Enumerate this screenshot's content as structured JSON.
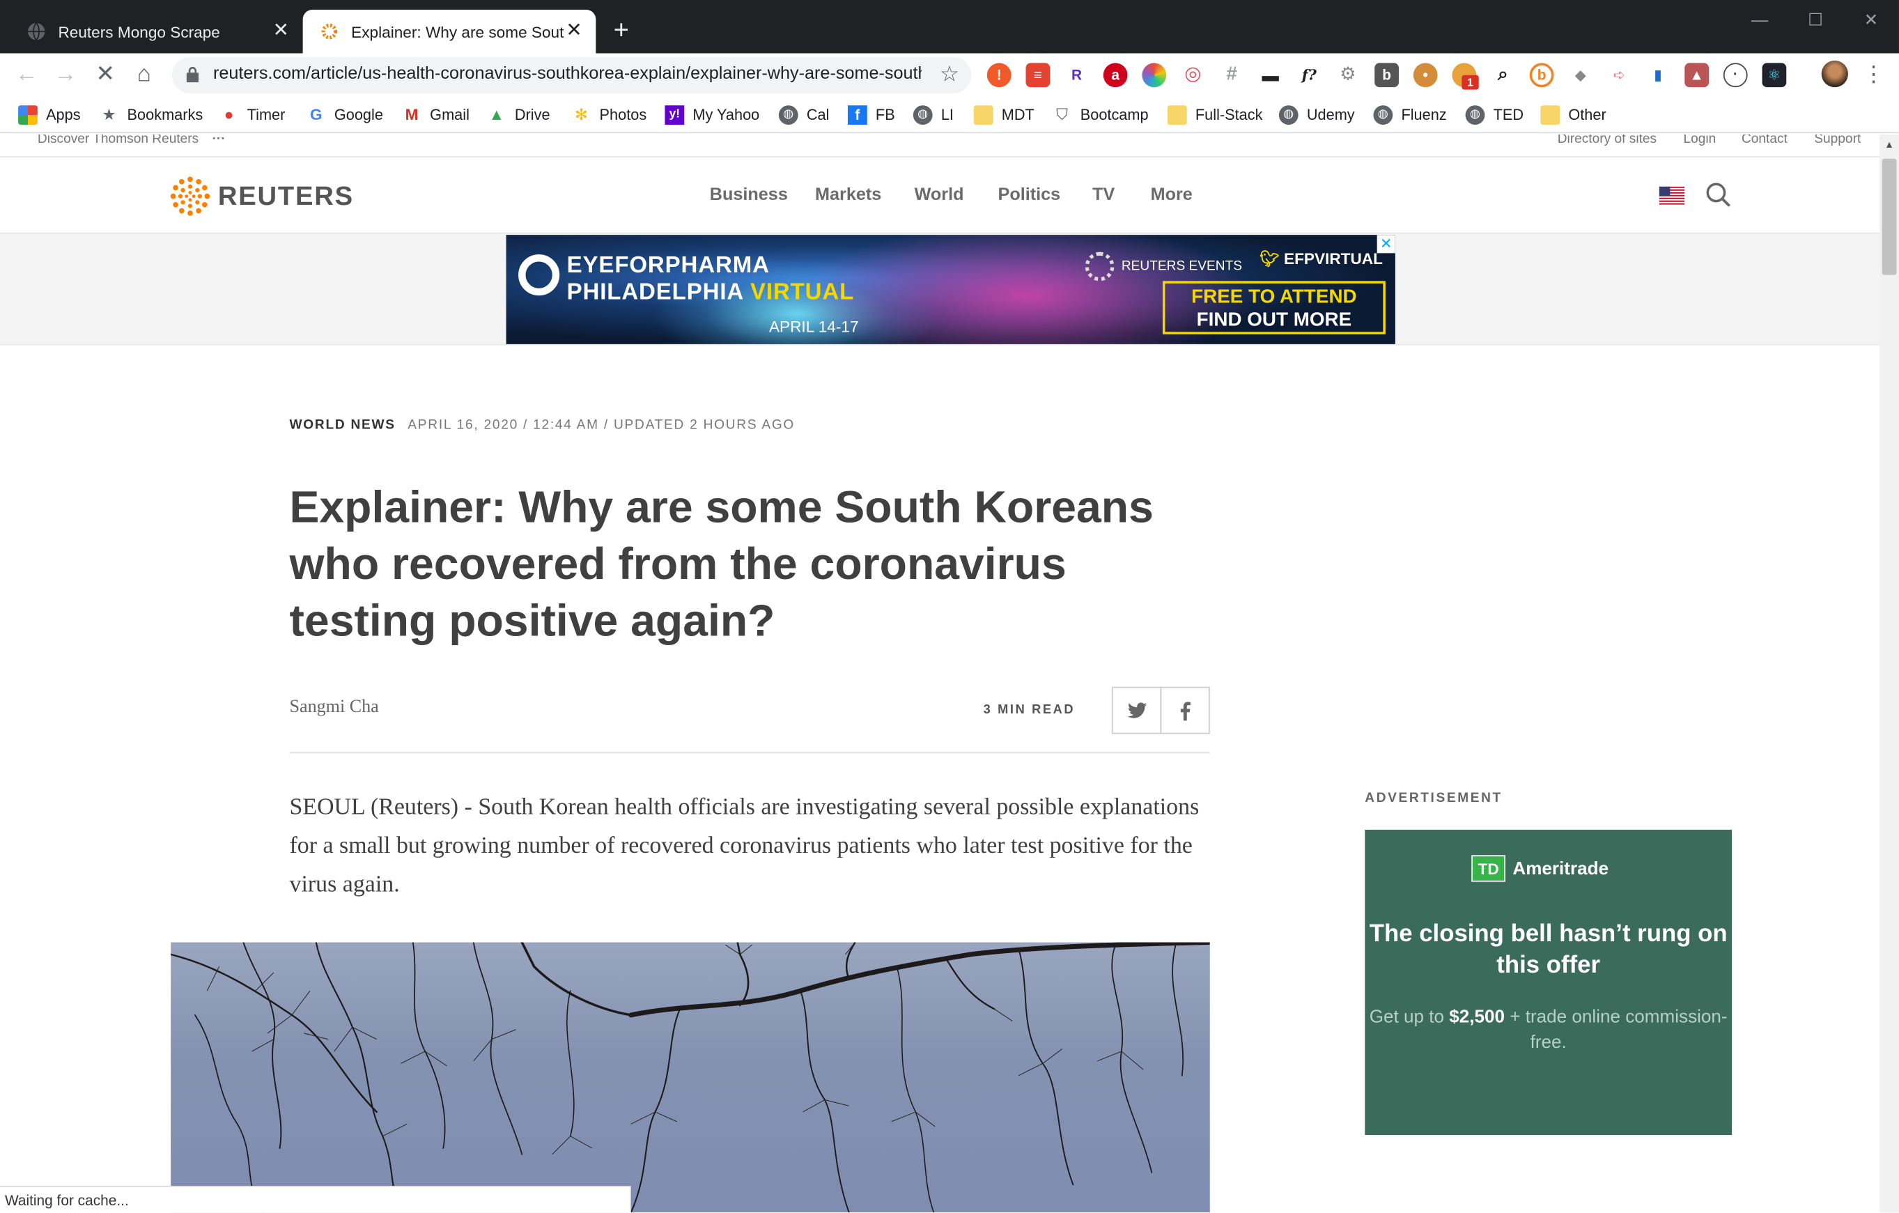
{
  "browser": {
    "tabs": [
      {
        "title": "Reuters Mongo Scrape",
        "active": false
      },
      {
        "title": "Explainer: Why are some South Koreans who recovered",
        "active": true
      }
    ],
    "url": "reuters.com/article/us-health-coronavirus-southkorea-explain/explainer-why-are-some-south-koreans",
    "status_text": "Waiting for cache...",
    "extension_badge": "1",
    "bookmarks": [
      {
        "label": "Apps",
        "icon": "apps-grid-icon"
      },
      {
        "label": "Bookmarks",
        "icon": "star-icon"
      },
      {
        "label": "Timer",
        "icon": "tomato-icon"
      },
      {
        "label": "Google",
        "icon": "google-icon"
      },
      {
        "label": "Gmail",
        "icon": "gmail-icon"
      },
      {
        "label": "Drive",
        "icon": "drive-icon"
      },
      {
        "label": "Photos",
        "icon": "photos-icon"
      },
      {
        "label": "My Yahoo",
        "icon": "yahoo-icon"
      },
      {
        "label": "Cal",
        "icon": "globe-icon"
      },
      {
        "label": "FB",
        "icon": "facebook-icon"
      },
      {
        "label": "LI",
        "icon": "globe-icon"
      },
      {
        "label": "MDT",
        "icon": "folder-icon"
      },
      {
        "label": "Bootcamp",
        "icon": "shield-icon"
      },
      {
        "label": "Full-Stack",
        "icon": "folder-icon"
      },
      {
        "label": "Udemy",
        "icon": "globe-icon"
      },
      {
        "label": "Fluenz",
        "icon": "globe-icon"
      },
      {
        "label": "TED",
        "icon": "globe-icon"
      },
      {
        "label": "Other",
        "icon": "folder-icon"
      }
    ]
  },
  "site": {
    "utility_left": "Discover Thomson Reuters",
    "utility_links": [
      "Directory of sites",
      "Login",
      "Contact",
      "Support"
    ],
    "logo": "REUTERS",
    "nav": [
      "Business",
      "Markets",
      "World",
      "Politics",
      "TV",
      "More"
    ]
  },
  "banner_ad": {
    "line1": "EYEFORPHARMA",
    "line2a": "PHILADELPHIA ",
    "line2b": "VIRTUAL",
    "date": "APRIL 14-17",
    "events": "REUTERS EVENTS",
    "twitter": "EFPVIRTUAL",
    "cta1": "FREE TO ATTEND",
    "cta2": "FIND OUT MORE"
  },
  "article": {
    "section": "WORLD NEWS",
    "dateline": "APRIL 16, 2020 / 12:44 AM / UPDATED 2 HOURS AGO",
    "headline": "Explainer: Why are some South Koreans who recovered from the coronavirus testing positive again?",
    "author": "Sangmi Cha",
    "read_time": "3 MIN READ",
    "lede": "SEOUL (Reuters) - South Korean health officials are investigating several possible explanations for a small but growing number of recovered coronavirus patients who later test positive for the virus again."
  },
  "sidebar_ad": {
    "label": "ADVERTISEMENT",
    "brand_box": "TD",
    "brand": "Ameritrade",
    "headline": "The closing bell hasn’t rung on this offer",
    "sub_a": "Get up to ",
    "sub_b": "$2,500",
    "sub_c": " + trade online commission-free."
  },
  "colors": {
    "reuters_orange": "#ff8000",
    "td_green": "#3a6b5b",
    "td_logo_green": "#37b34a",
    "banner_yellow": "#f5d800"
  }
}
